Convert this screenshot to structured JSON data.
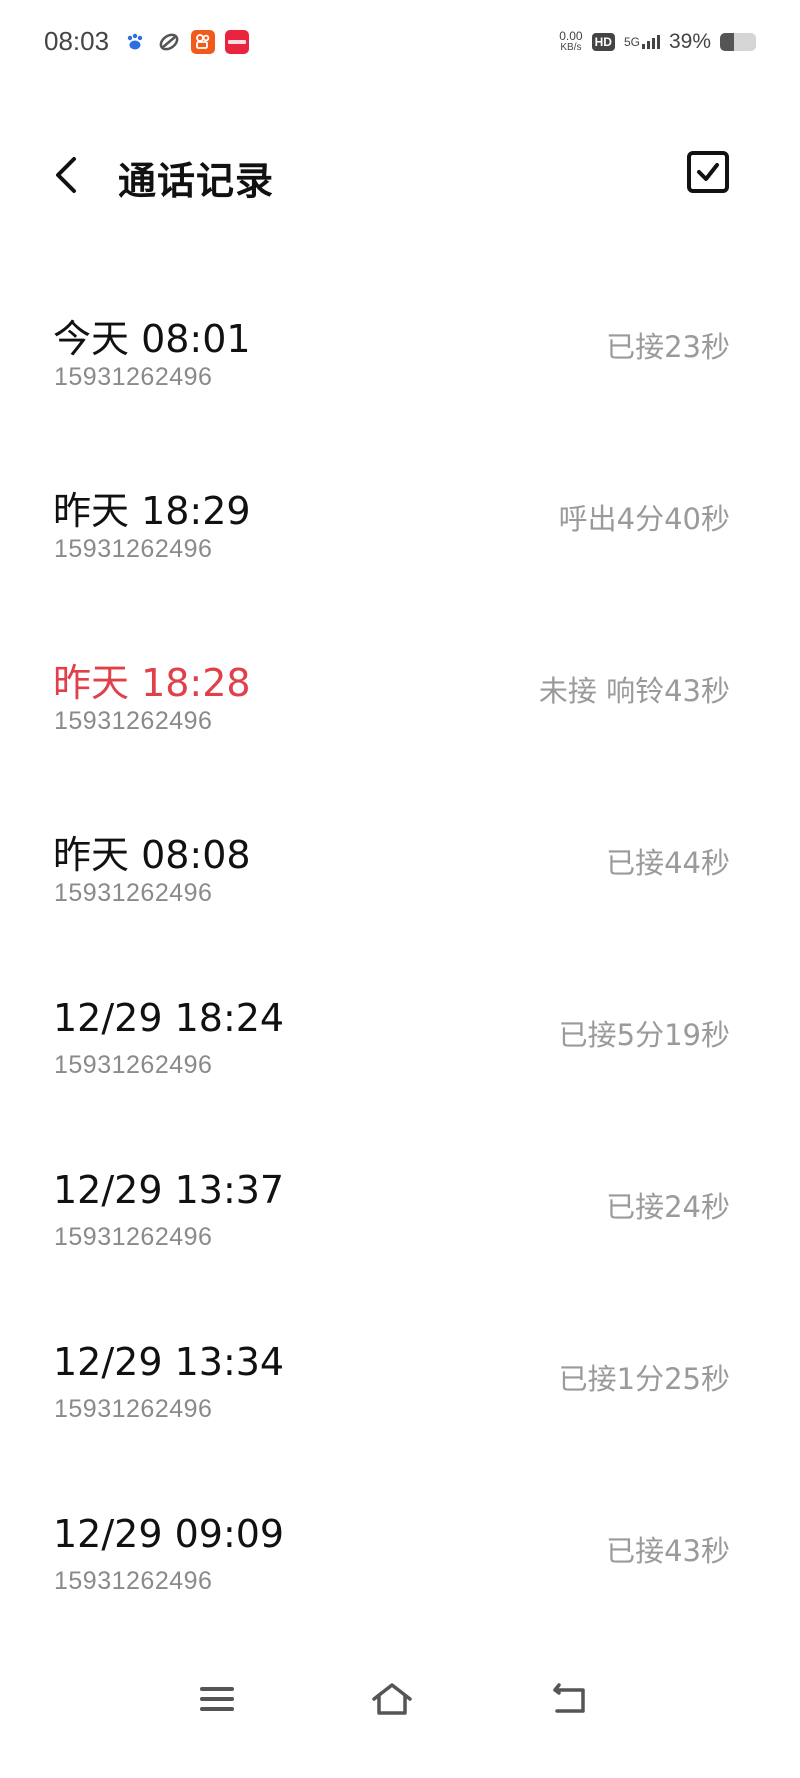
{
  "status_bar": {
    "time": "08:03",
    "net_speed_value": "0.00",
    "net_speed_unit": "KB/s",
    "hd": "HD",
    "signal": "5G",
    "battery_text": "39%",
    "battery_level": 0.39,
    "app_icons": [
      "baidu-icon",
      "link-icon",
      "kuaishou-icon",
      "xiaohongshu-icon"
    ]
  },
  "header": {
    "title": "通话记录"
  },
  "calls": [
    {
      "time": "今天 08:01",
      "number": "15931262496",
      "status": "已接23秒",
      "missed": false
    },
    {
      "time": "昨天 18:29",
      "number": "15931262496",
      "status": "呼出4分40秒",
      "missed": false
    },
    {
      "time": "昨天 18:28",
      "number": "15931262496",
      "status": "未接 响铃43秒",
      "missed": true
    },
    {
      "time": "昨天 08:08",
      "number": "15931262496",
      "status": "已接44秒",
      "missed": false
    },
    {
      "time": "12/29 18:24",
      "number": "15931262496",
      "status": "已接5分19秒",
      "missed": false
    },
    {
      "time": "12/29 13:37",
      "number": "15931262496",
      "status": "已接24秒",
      "missed": false
    },
    {
      "time": "12/29 13:34",
      "number": "15931262496",
      "status": "已接1分25秒",
      "missed": false
    },
    {
      "time": "12/29 09:09",
      "number": "15931262496",
      "status": "已接43秒",
      "missed": false
    }
  ],
  "colors": {
    "missed": "#e0404a",
    "secondary_text": "#8a8a8a",
    "status_text": "#9a9a9a"
  }
}
